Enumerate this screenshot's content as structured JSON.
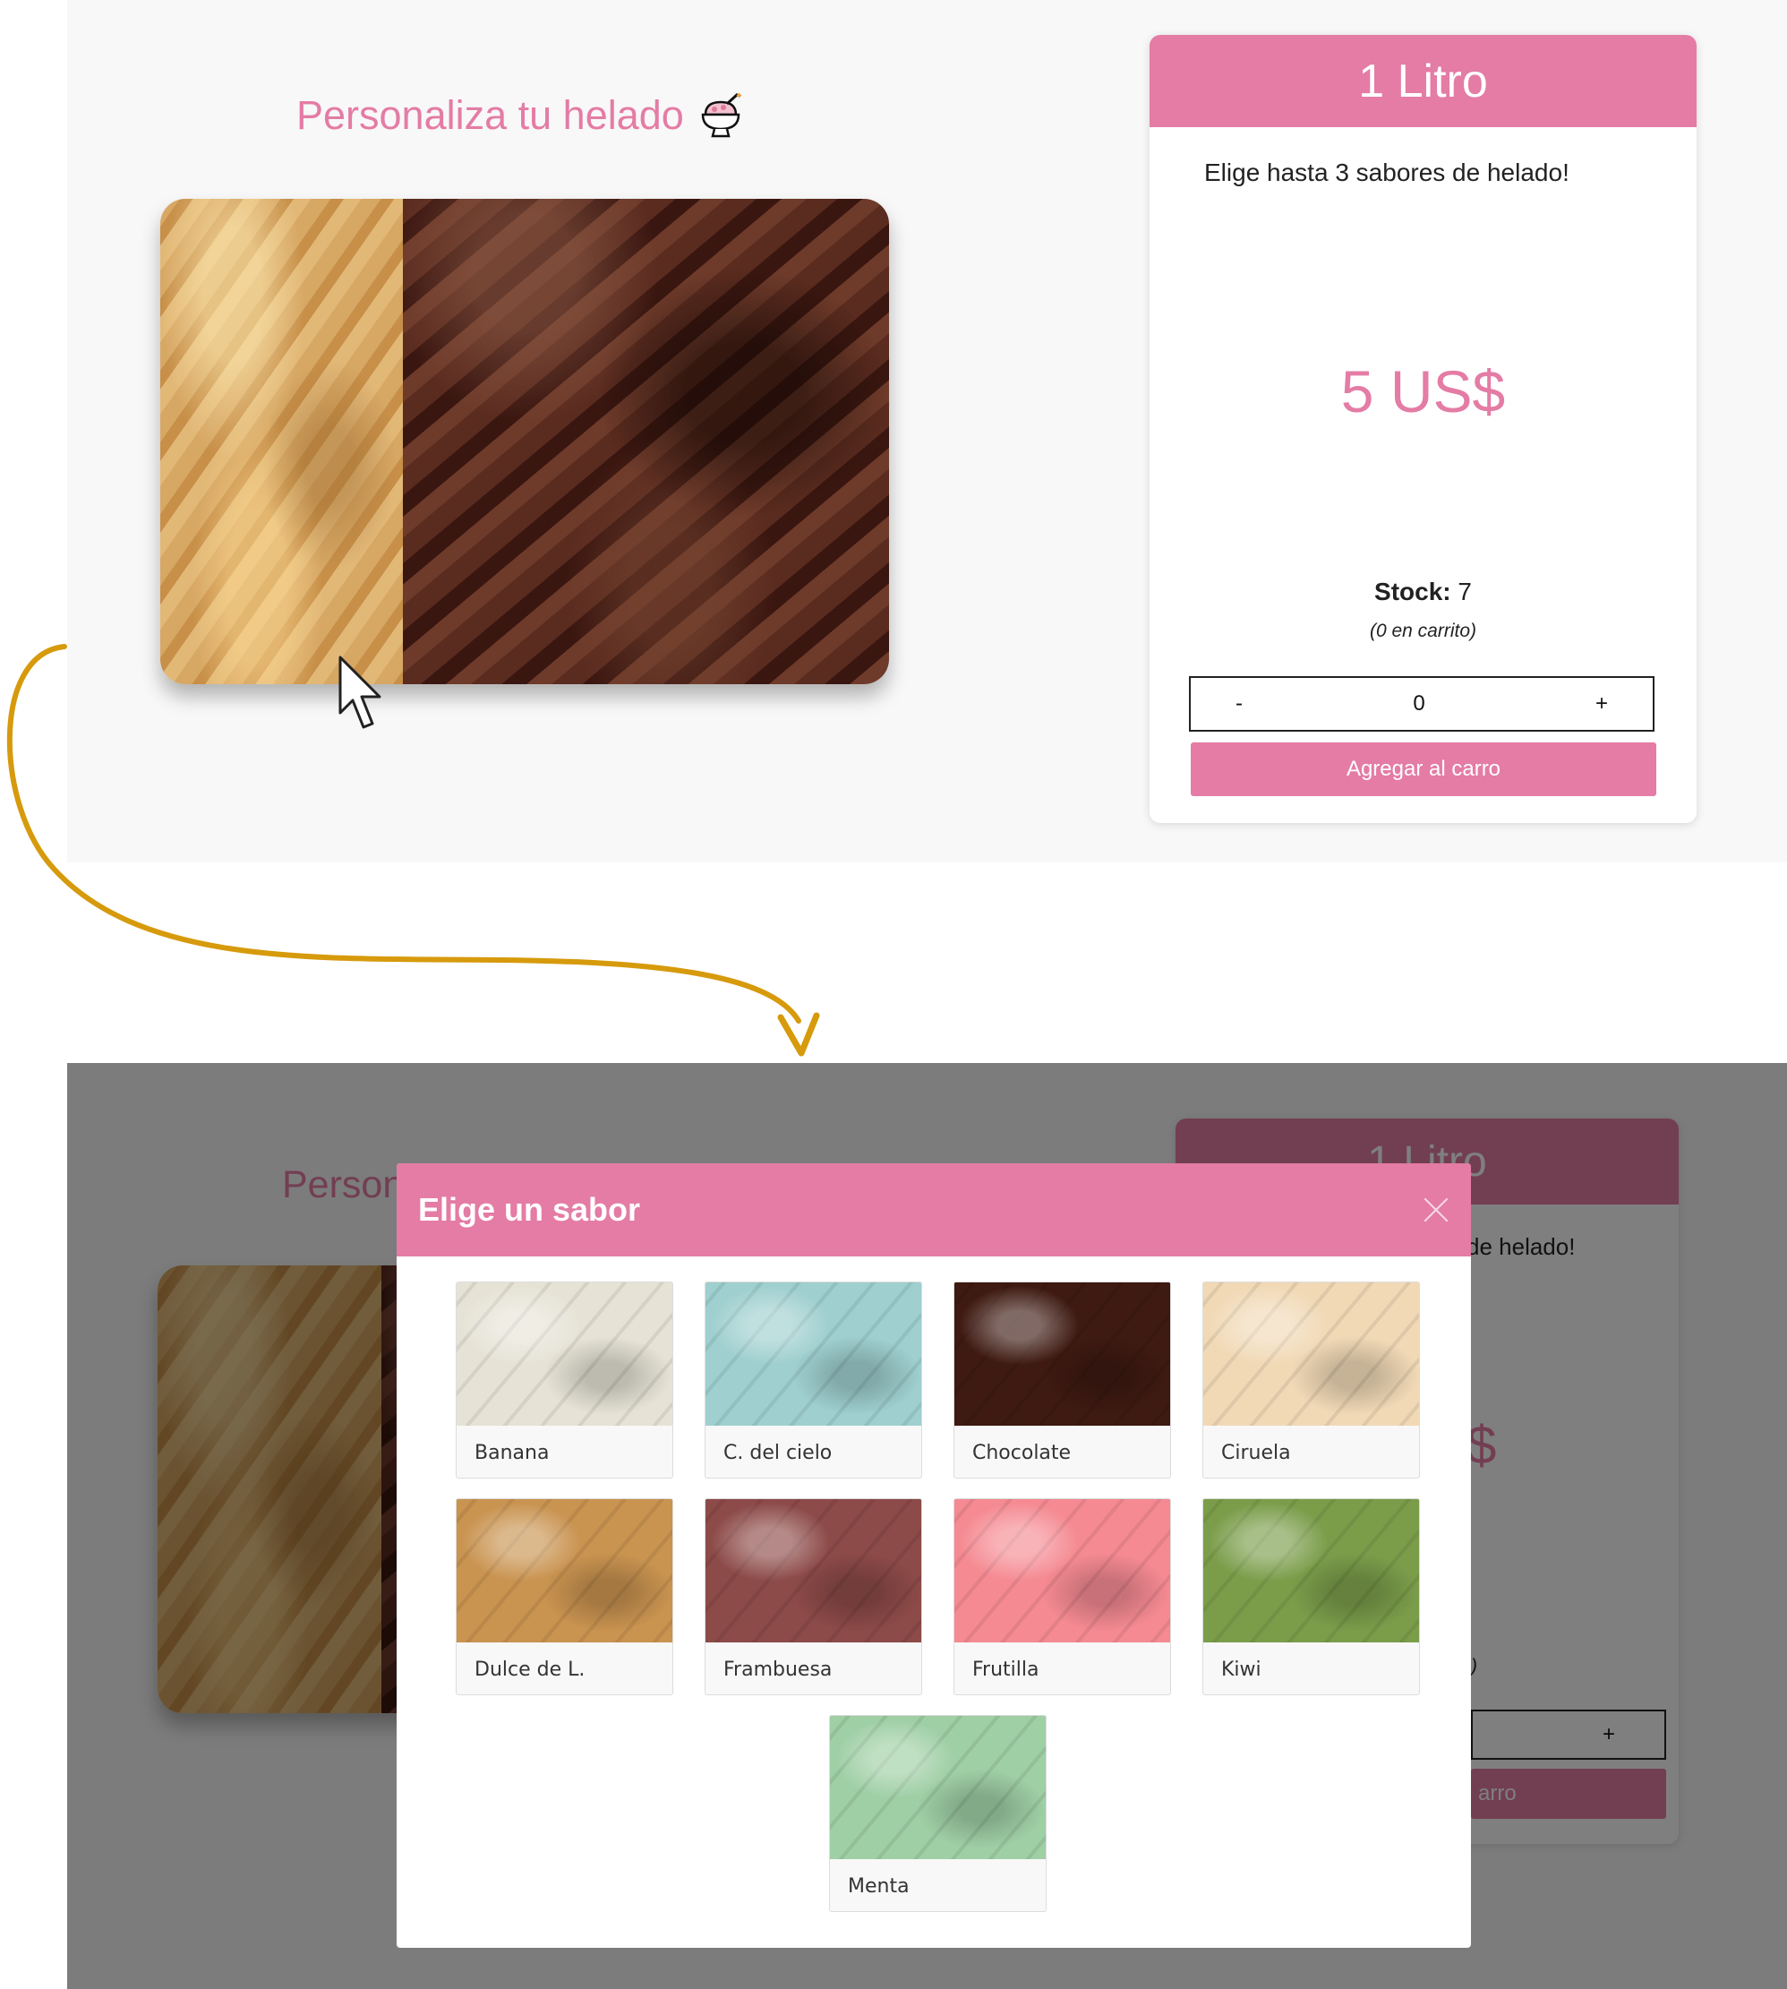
{
  "before": {
    "title": "Personaliza tu helado",
    "title_icon": "shaved-ice-bowl-icon",
    "card": {
      "header": "1 Litro",
      "description": "Elige hasta 3 sabores de helado!",
      "price": "5 US$",
      "stock_label": "Stock:",
      "stock_value": "7",
      "in_cart": "(0 en carrito)",
      "qty_minus": "-",
      "qty_value": "0",
      "qty_plus": "+",
      "add_button": "Agregar al carro"
    }
  },
  "after": {
    "title_partial": "Person",
    "card_header": "1 Litro",
    "desc_partial": "de helado!",
    "price_partial": "$",
    "cart_partial": ")",
    "qty_plus": "+",
    "add_partial": "arro",
    "modal": {
      "title": "Elige un sabor",
      "flavors": [
        {
          "name": "Banana",
          "color": "#e6e3d6"
        },
        {
          "name": "C. del cielo",
          "color": "#9fcfcf"
        },
        {
          "name": "Chocolate",
          "color": "#3e1a12"
        },
        {
          "name": "Ciruela",
          "color": "#f1d9b6"
        },
        {
          "name": "Dulce de L.",
          "color": "#c99350"
        },
        {
          "name": "Frambuesa",
          "color": "#8c4a48"
        },
        {
          "name": "Frutilla",
          "color": "#f58a92"
        },
        {
          "name": "Kiwi",
          "color": "#7b9d4a"
        },
        {
          "name": "Menta",
          "color": "#9fcfa5"
        }
      ]
    }
  },
  "colors": {
    "accent": "#e47ca5",
    "arrow": "#d69a0c"
  }
}
